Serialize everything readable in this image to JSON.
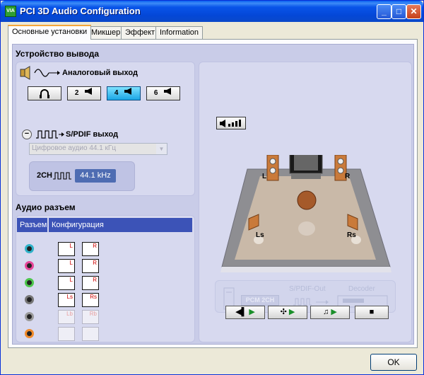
{
  "window": {
    "title": "PCI 3D Audio Configuration",
    "icon_text": "VIA"
  },
  "tabs": [
    {
      "label": "Основные установки",
      "active": true
    },
    {
      "label": "Микшер"
    },
    {
      "label": "Эффект"
    },
    {
      "label": "Information"
    }
  ],
  "output_device": {
    "title": "Устройство вывода",
    "analog_label": "Аналоговый выход",
    "modes": [
      {
        "label": "",
        "icon": "headphones-icon"
      },
      {
        "label": "2",
        "icon": "speaker-icon"
      },
      {
        "label": "4",
        "icon": "speaker-icon",
        "selected": true
      },
      {
        "label": "6",
        "icon": "speaker-icon"
      }
    ],
    "spdif_label": "S/PDIF выход",
    "spdif_select_value": "Цифровое аудио 44.1 кГц",
    "spdif_channels": "2CH",
    "spdif_freq": "44.1 kHz"
  },
  "audio_jack": {
    "title": "Аудио разъем",
    "col_jack": "Разъем",
    "col_config": "Конфигурация",
    "rows": [
      {
        "color": "#2FB2C9",
        "left": "L",
        "right": "R"
      },
      {
        "color": "#E7469A",
        "left": "L",
        "right": "R"
      },
      {
        "color": "#4CC64C",
        "left": "L",
        "right": "R"
      },
      {
        "color": "#777777",
        "left": "Ls",
        "right": "Rs"
      },
      {
        "color": "#9A9A9A",
        "left": "Lb",
        "right": "Rb"
      },
      {
        "color": "#F08A2A",
        "left": "",
        "right": ""
      }
    ]
  },
  "speaker_view": {
    "labels": {
      "l": "L",
      "r": "R",
      "ls": "Ls",
      "rs": "Rs"
    },
    "pcm_label": "PCM 2CH",
    "spdif_out_label": "S/PDIF-Out",
    "decoder_label": "Decoder"
  },
  "ok_label": "OK"
}
